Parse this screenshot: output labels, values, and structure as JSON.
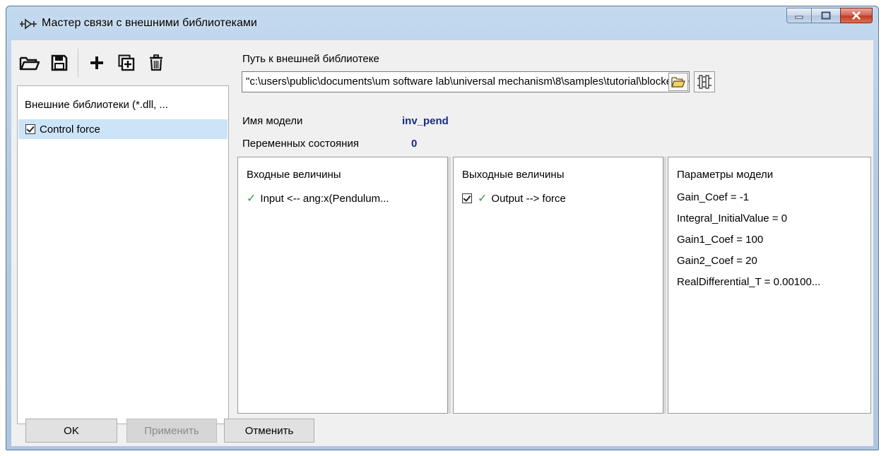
{
  "window": {
    "title": "Мастер связи с внешними библиотеками"
  },
  "toolbar": {
    "buttons": [
      "open-icon",
      "save-icon",
      "add-icon",
      "duplicate-icon",
      "delete-icon"
    ]
  },
  "libraries": {
    "header": "Внешние библиотеки (*.dll, ...",
    "items": [
      {
        "label": "Control force",
        "checked": true,
        "selected": true
      }
    ]
  },
  "path": {
    "label": "Путь к внешней библиотеке",
    "value": "\"c:\\users\\public\\documents\\um software lab\\universal mechanism\\8\\samples\\tutorial\\blockediter\\inv_pend.dll\""
  },
  "model": {
    "name_label": "Имя модели",
    "name_value": "inv_pend",
    "states_label": "Переменных состояния",
    "states_value": "0"
  },
  "inputs": {
    "title": "Входные величины",
    "items": [
      {
        "label": "Input <-- ang:x(Pendulum...",
        "ok": true
      }
    ]
  },
  "outputs": {
    "title": "Выходные величины",
    "items": [
      {
        "label": "Output --> force",
        "ok": true,
        "checked": true
      }
    ]
  },
  "parameters": {
    "title": "Параметры модели",
    "items": [
      "Gain_Coef = -1",
      "Integral_InitialValue = 0",
      "Gain1_Coef = 100",
      "Gain2_Coef = 20",
      "RealDifferential_T = 0.00100..."
    ]
  },
  "buttons": {
    "ok": "OK",
    "apply": "Применить",
    "cancel": "Отменить"
  },
  "colors": {
    "accent_value": "#1a2a8a",
    "selection": "#cce4f7",
    "check_ok": "#2ea043"
  }
}
